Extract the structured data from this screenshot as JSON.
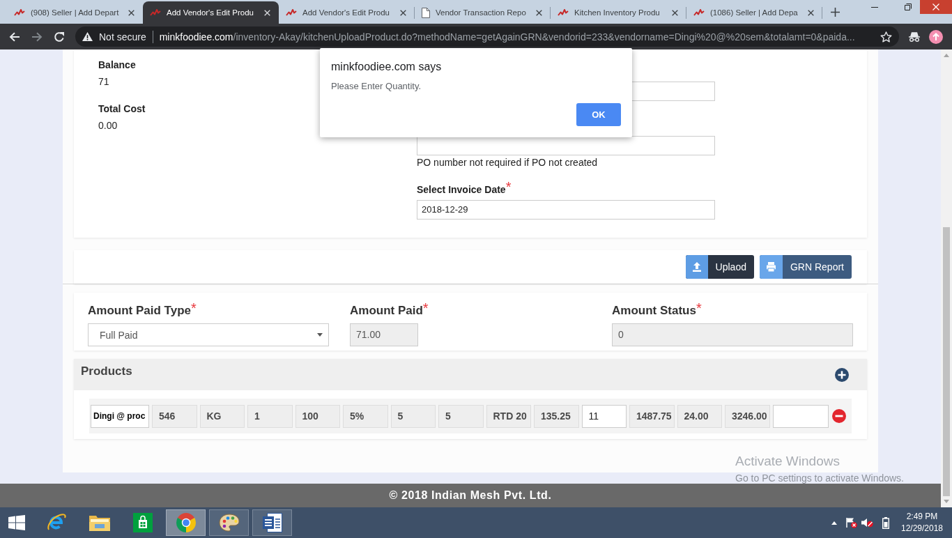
{
  "browser": {
    "tabs": [
      {
        "title": "(908) Seller | Add Depart",
        "kind": "site",
        "selected": false
      },
      {
        "title": "Add Vendor's Edit Produ",
        "kind": "site",
        "selected": true
      },
      {
        "title": "Add Vendor's Edit Produ",
        "kind": "site",
        "selected": false
      },
      {
        "title": "Vendor Transaction Repo",
        "kind": "page",
        "selected": false
      },
      {
        "title": "Kitchen Inventory Produ",
        "kind": "site",
        "selected": false
      },
      {
        "title": "(1086) Seller | Add Depa",
        "kind": "site",
        "selected": false
      }
    ],
    "address": {
      "security": "Not secure",
      "host": "minkfoodiee.com",
      "path": "/inventory-Akay/kitchenUploadProduct.do?methodName=getAgainGRN&vendorid=233&vendorname=Dingi%20@%20sem&totalamt=0&paida..."
    }
  },
  "summary": [
    {
      "label": "Balance",
      "value": "71"
    },
    {
      "label": "Total Cost",
      "value": "0.00"
    }
  ],
  "invoice_fields": [
    {
      "kind": "input"
    },
    {
      "kind": "input",
      "note": "PO number not required if PO not created"
    },
    {
      "kind": "input",
      "label": "Select Invoice Date",
      "mark": "*",
      "value": "2018-12-29"
    }
  ],
  "actions": [
    {
      "kind": "upload",
      "label": "Uplaod"
    },
    {
      "kind": "print",
      "label": "GRN Report"
    }
  ],
  "payment": [
    {
      "kind": "select",
      "label": "Amount Paid Type",
      "mark": "*",
      "value": "Full Paid"
    },
    {
      "kind": "readonly",
      "label": "Amount Paid",
      "mark": "*",
      "value": "71.00"
    },
    {
      "kind": "readonly",
      "label": "Amount Status",
      "mark": "*",
      "value": "0"
    }
  ],
  "products": {
    "title": "Products",
    "rows": [
      {
        "cells": [
          {
            "value": "Dingi @ proc",
            "editable": true
          },
          {
            "value": "546",
            "editable": false
          },
          {
            "value": "KG",
            "editable": false
          },
          {
            "value": "1",
            "editable": false
          },
          {
            "value": "100",
            "editable": false
          },
          {
            "value": "5%",
            "editable": false
          },
          {
            "value": "5",
            "editable": false
          },
          {
            "value": "5",
            "editable": false
          },
          {
            "value": "RTD 20",
            "editable": false
          },
          {
            "value": "135.25",
            "editable": false
          },
          {
            "value": "11",
            "editable": true
          },
          {
            "value": "1487.75",
            "editable": false
          },
          {
            "value": "24.00",
            "editable": false
          },
          {
            "value": "3246.00",
            "editable": false
          },
          {
            "editable": true
          }
        ]
      }
    ]
  },
  "footer": "© 2018 Indian Mesh Pvt. Ltd.",
  "dialog": {
    "title": "minkfoodiee.com says",
    "message": "Please Enter Quantity.",
    "button": "OK"
  },
  "activation_notice": {
    "title": "Activate Windows",
    "text": "Go to PC settings to activate Windows."
  },
  "taskbar": {
    "apps": [
      {
        "kind": "e-browser",
        "running": false,
        "selected": false
      },
      {
        "kind": "files",
        "running": false,
        "selected": false
      },
      {
        "kind": "store",
        "running": false,
        "selected": false
      },
      {
        "kind": "web",
        "running": true,
        "selected": true
      },
      {
        "kind": "paint",
        "running": true,
        "selected": false
      },
      {
        "kind": "word",
        "running": true,
        "selected": false
      }
    ],
    "clock": {
      "time": "2:49 PM",
      "date": "12/29/2018"
    }
  }
}
